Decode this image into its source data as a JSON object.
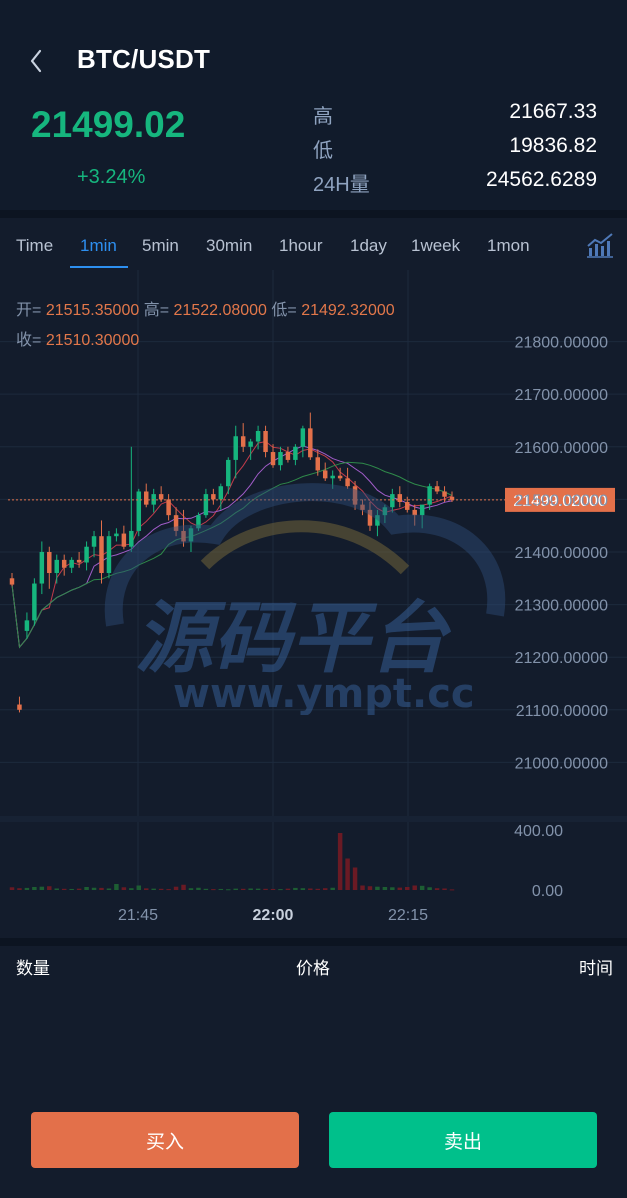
{
  "header": {
    "pair": "BTC/USDT",
    "price": "21499.02",
    "change": "+3.24%",
    "stats": [
      {
        "label": "高",
        "value": "21667.33"
      },
      {
        "label": "低",
        "value": "19836.82"
      },
      {
        "label": "24H量",
        "value": "24562.6289"
      }
    ]
  },
  "tabs": [
    "Time",
    "1min",
    "5min",
    "30min",
    "1hour",
    "1day",
    "1week",
    "1mon"
  ],
  "active_tab": "1min",
  "ohlc": {
    "open_label": "开=",
    "open": "21515.35000",
    "high_label": "高=",
    "high": "21522.08000",
    "low_label": "低=",
    "low": "21492.32000",
    "close_label": "收=",
    "close": "21510.30000"
  },
  "chart_data": {
    "type": "candlestick",
    "price_axis": [
      "21800.00000",
      "21700.00000",
      "21600.00000",
      "21500.00000",
      "21400.00000",
      "21300.00000",
      "21200.00000",
      "21100.00000",
      "21000.00000"
    ],
    "current_price": "21499.02000",
    "volume_axis": [
      "400.00",
      "0.00"
    ],
    "time_axis": [
      "21:45",
      "22:00",
      "22:15"
    ],
    "ylim": [
      20900,
      21860
    ],
    "volume_ylim": [
      0,
      400
    ],
    "candles": [
      {
        "o": 21350,
        "h": 21360,
        "l": 21335,
        "c": 21338
      },
      {
        "o": 21110,
        "h": 21125,
        "l": 21095,
        "c": 21100
      },
      {
        "o": 21250,
        "h": 21285,
        "l": 21235,
        "c": 21270
      },
      {
        "o": 21270,
        "h": 21350,
        "l": 21260,
        "c": 21340
      },
      {
        "o": 21340,
        "h": 21420,
        "l": 21320,
        "c": 21400
      },
      {
        "o": 21400,
        "h": 21410,
        "l": 21330,
        "c": 21360
      },
      {
        "o": 21360,
        "h": 21395,
        "l": 21340,
        "c": 21385
      },
      {
        "o": 21385,
        "h": 21395,
        "l": 21355,
        "c": 21370
      },
      {
        "o": 21370,
        "h": 21390,
        "l": 21360,
        "c": 21385
      },
      {
        "o": 21385,
        "h": 21400,
        "l": 21370,
        "c": 21380
      },
      {
        "o": 21380,
        "h": 21420,
        "l": 21365,
        "c": 21410
      },
      {
        "o": 21410,
        "h": 21440,
        "l": 21390,
        "c": 21430
      },
      {
        "o": 21430,
        "h": 21460,
        "l": 21340,
        "c": 21360
      },
      {
        "o": 21360,
        "h": 21440,
        "l": 21350,
        "c": 21430
      },
      {
        "o": 21430,
        "h": 21445,
        "l": 21420,
        "c": 21435
      },
      {
        "o": 21435,
        "h": 21450,
        "l": 21405,
        "c": 21410
      },
      {
        "o": 21410,
        "h": 21600,
        "l": 21400,
        "c": 21440
      },
      {
        "o": 21440,
        "h": 21520,
        "l": 21430,
        "c": 21515
      },
      {
        "o": 21515,
        "h": 21530,
        "l": 21485,
        "c": 21490
      },
      {
        "o": 21490,
        "h": 21520,
        "l": 21475,
        "c": 21510
      },
      {
        "o": 21510,
        "h": 21525,
        "l": 21495,
        "c": 21500
      },
      {
        "o": 21500,
        "h": 21510,
        "l": 21460,
        "c": 21470
      },
      {
        "o": 21470,
        "h": 21485,
        "l": 21430,
        "c": 21440
      },
      {
        "o": 21440,
        "h": 21480,
        "l": 21410,
        "c": 21420
      },
      {
        "o": 21420,
        "h": 21450,
        "l": 21400,
        "c": 21445
      },
      {
        "o": 21445,
        "h": 21475,
        "l": 21440,
        "c": 21470
      },
      {
        "o": 21470,
        "h": 21520,
        "l": 21465,
        "c": 21510
      },
      {
        "o": 21510,
        "h": 21520,
        "l": 21490,
        "c": 21500
      },
      {
        "o": 21500,
        "h": 21530,
        "l": 21480,
        "c": 21525
      },
      {
        "o": 21525,
        "h": 21580,
        "l": 21510,
        "c": 21575
      },
      {
        "o": 21575,
        "h": 21640,
        "l": 21540,
        "c": 21620
      },
      {
        "o": 21620,
        "h": 21645,
        "l": 21590,
        "c": 21600
      },
      {
        "o": 21600,
        "h": 21615,
        "l": 21575,
        "c": 21610
      },
      {
        "o": 21610,
        "h": 21640,
        "l": 21595,
        "c": 21630
      },
      {
        "o": 21630,
        "h": 21640,
        "l": 21580,
        "c": 21590
      },
      {
        "o": 21590,
        "h": 21605,
        "l": 21560,
        "c": 21565
      },
      {
        "o": 21565,
        "h": 21600,
        "l": 21555,
        "c": 21590
      },
      {
        "o": 21590,
        "h": 21600,
        "l": 21570,
        "c": 21575
      },
      {
        "o": 21575,
        "h": 21605,
        "l": 21565,
        "c": 21600
      },
      {
        "o": 21600,
        "h": 21640,
        "l": 21580,
        "c": 21635
      },
      {
        "o": 21635,
        "h": 21665,
        "l": 21575,
        "c": 21580
      },
      {
        "o": 21580,
        "h": 21595,
        "l": 21545,
        "c": 21555
      },
      {
        "o": 21555,
        "h": 21570,
        "l": 21535,
        "c": 21540
      },
      {
        "o": 21540,
        "h": 21555,
        "l": 21520,
        "c": 21545
      },
      {
        "o": 21545,
        "h": 21560,
        "l": 21535,
        "c": 21540
      },
      {
        "o": 21540,
        "h": 21560,
        "l": 21520,
        "c": 21525
      },
      {
        "o": 21525,
        "h": 21535,
        "l": 21480,
        "c": 21490
      },
      {
        "o": 21490,
        "h": 21500,
        "l": 21470,
        "c": 21480
      },
      {
        "o": 21480,
        "h": 21495,
        "l": 21440,
        "c": 21450
      },
      {
        "o": 21450,
        "h": 21480,
        "l": 21430,
        "c": 21470
      },
      {
        "o": 21470,
        "h": 21490,
        "l": 21455,
        "c": 21485
      },
      {
        "o": 21485,
        "h": 21520,
        "l": 21475,
        "c": 21510
      },
      {
        "o": 21510,
        "h": 21525,
        "l": 21485,
        "c": 21495
      },
      {
        "o": 21495,
        "h": 21505,
        "l": 21475,
        "c": 21480
      },
      {
        "o": 21480,
        "h": 21490,
        "l": 21450,
        "c": 21470
      },
      {
        "o": 21470,
        "h": 21480,
        "l": 21445,
        "c": 21490
      },
      {
        "o": 21490,
        "h": 21530,
        "l": 21480,
        "c": 21525
      },
      {
        "o": 21525,
        "h": 21535,
        "l": 21510,
        "c": 21515
      },
      {
        "o": 21515,
        "h": 21525,
        "l": 21495,
        "c": 21505
      },
      {
        "o": 21505,
        "h": 21515,
        "l": 21495,
        "c": 21499
      }
    ],
    "volumes": [
      18,
      12,
      14,
      20,
      22,
      25,
      10,
      8,
      7,
      9,
      20,
      15,
      14,
      10,
      40,
      18,
      12,
      30,
      11,
      9,
      8,
      6,
      22,
      35,
      12,
      15,
      8,
      6,
      7,
      5,
      9,
      8,
      10,
      9,
      8,
      7,
      6,
      9,
      14,
      12,
      10,
      8,
      12,
      15,
      380,
      210,
      150,
      30,
      25,
      22,
      20,
      18,
      16,
      20,
      30,
      28,
      18,
      12,
      10,
      4
    ]
  },
  "watermark": {
    "cn": "源码平台",
    "url": "www.ympt.cc"
  },
  "trades": {
    "qty": "数量",
    "price": "价格",
    "time": "时间"
  },
  "buttons": {
    "buy": "买入",
    "sell": "卖出"
  },
  "colors": {
    "up": "#16b67e",
    "down": "#e3704a",
    "accent": "#2d8ff0",
    "bg": "#131c2c"
  }
}
